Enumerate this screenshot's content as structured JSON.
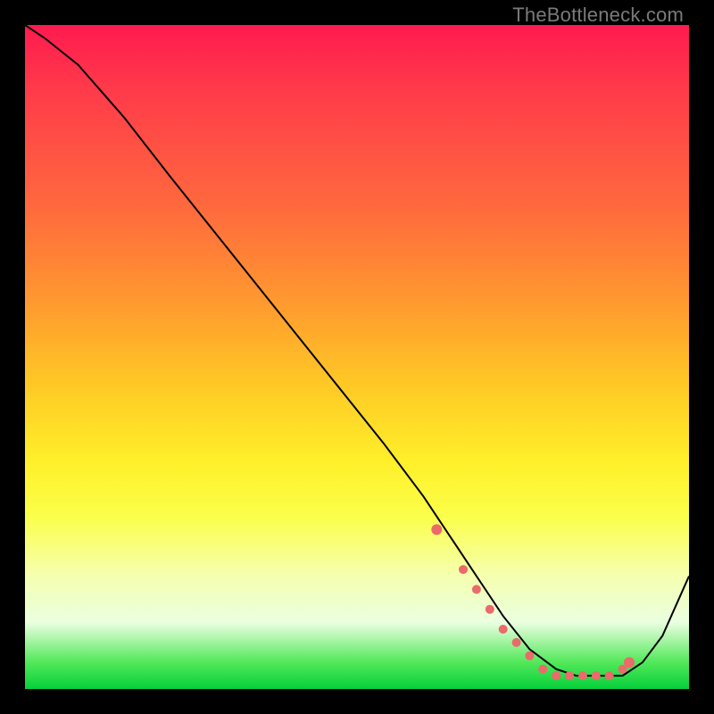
{
  "watermark": "TheBottleneck.com",
  "colors": {
    "page_bg": "#000000",
    "curve_stroke": "#000000",
    "dot_fill": "#eb6a6a",
    "gradient_stops": [
      "#ff1a4f",
      "#ff3b4a",
      "#ff6b3d",
      "#ff9a2f",
      "#ffc825",
      "#fff02a",
      "#fbff4a",
      "#f5ffb0",
      "#eaffe0",
      "#52e85a",
      "#05d03a"
    ]
  },
  "chart_data": {
    "type": "line",
    "title": "",
    "xlabel": "",
    "ylabel": "",
    "xlim": [
      0,
      100
    ],
    "ylim": [
      0,
      100
    ],
    "grid": false,
    "legend": false,
    "series": [
      {
        "name": "bottleneck-curve",
        "x": [
          0,
          3,
          8,
          15,
          22,
          30,
          38,
          46,
          54,
          60,
          64,
          68,
          72,
          76,
          80,
          83,
          86,
          88,
          90,
          93,
          96,
          100
        ],
        "y": [
          100,
          98,
          94,
          86,
          77,
          67,
          57,
          47,
          37,
          29,
          23,
          17,
          11,
          6,
          3,
          2,
          2,
          2,
          2,
          4,
          8,
          17
        ]
      }
    ],
    "highlight_dots": {
      "series": "bottleneck-curve",
      "x": [
        62,
        66,
        68,
        70,
        72,
        74,
        76,
        78,
        80,
        82,
        84,
        86,
        88,
        90,
        91
      ],
      "y": [
        24,
        18,
        15,
        12,
        9,
        7,
        5,
        3,
        2,
        2,
        2,
        2,
        2,
        3,
        4
      ]
    }
  }
}
